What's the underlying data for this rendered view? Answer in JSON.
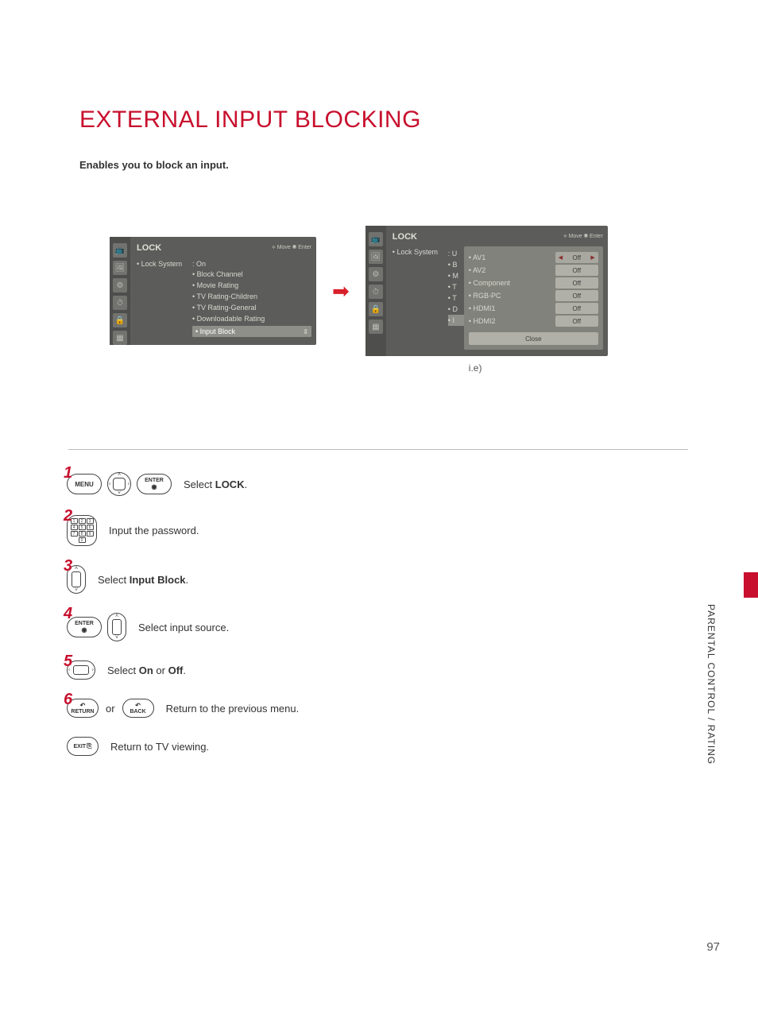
{
  "title": "EXTERNAL INPUT BLOCKING",
  "subtitle": "Enables you to block an input.",
  "osd1": {
    "title": "LOCK",
    "hints": "⟡ Move   ◉ Enter",
    "lock_system_label": "• Lock System",
    "lock_system_value": ": On",
    "items": {
      "block_channel": "• Block Channel",
      "movie_rating": "• Movie Rating",
      "tv_children": "• TV Rating-Children",
      "tv_general": "• TV Rating-General",
      "downloadable": "• Downloadable Rating",
      "input_block": "• Input Block"
    },
    "icons": [
      "📺",
      "🖼",
      "⚙",
      "⏱",
      "🔒",
      "▦"
    ]
  },
  "osd2": {
    "title": "LOCK",
    "hints": "⟡ Move   ◉ Enter",
    "lock_system_label": "• Lock System",
    "mid": [
      ": U",
      "• B",
      "• M",
      "• T",
      "• T",
      "• D",
      "• I"
    ],
    "inputs": [
      {
        "label": "• AV1",
        "value": "Off",
        "active": true
      },
      {
        "label": "• AV2",
        "value": "Off",
        "active": false
      },
      {
        "label": "• Component",
        "value": "Off",
        "active": false
      },
      {
        "label": "• RGB-PC",
        "value": "Off",
        "active": false
      },
      {
        "label": "• HDMI1",
        "value": "Off",
        "active": false
      },
      {
        "label": "• HDMI2",
        "value": "Off",
        "active": false
      }
    ],
    "close_label": "Close",
    "note": "i.e)",
    "icons": [
      "📺",
      "🖼",
      "⚙",
      "⏱",
      "🔒",
      "▦"
    ]
  },
  "steps": {
    "s1": {
      "num": "1",
      "menu": "MENU",
      "enter": "ENTER",
      "text_pre": "Select ",
      "text_b": "LOCK",
      "text_post": "."
    },
    "s2": {
      "num": "2",
      "text": "Input the password."
    },
    "s3": {
      "num": "3",
      "text_pre": "Select ",
      "text_b": "Input Block",
      "text_post": "."
    },
    "s4": {
      "num": "4",
      "enter": "ENTER",
      "text": "Select input source."
    },
    "s5": {
      "num": "5",
      "text_pre": "Select ",
      "text_b1": "On",
      "text_mid": " or ",
      "text_b2": "Off",
      "text_post": "."
    },
    "s6": {
      "num": "6",
      "return": "RETURN",
      "or": "or",
      "back": "BACK",
      "text": "Return to the previous menu."
    },
    "s7": {
      "exit": "EXIT",
      "text": "Return to TV viewing."
    }
  },
  "side_label": "PARENTAL CONTROL / RATING",
  "page_number": "97"
}
